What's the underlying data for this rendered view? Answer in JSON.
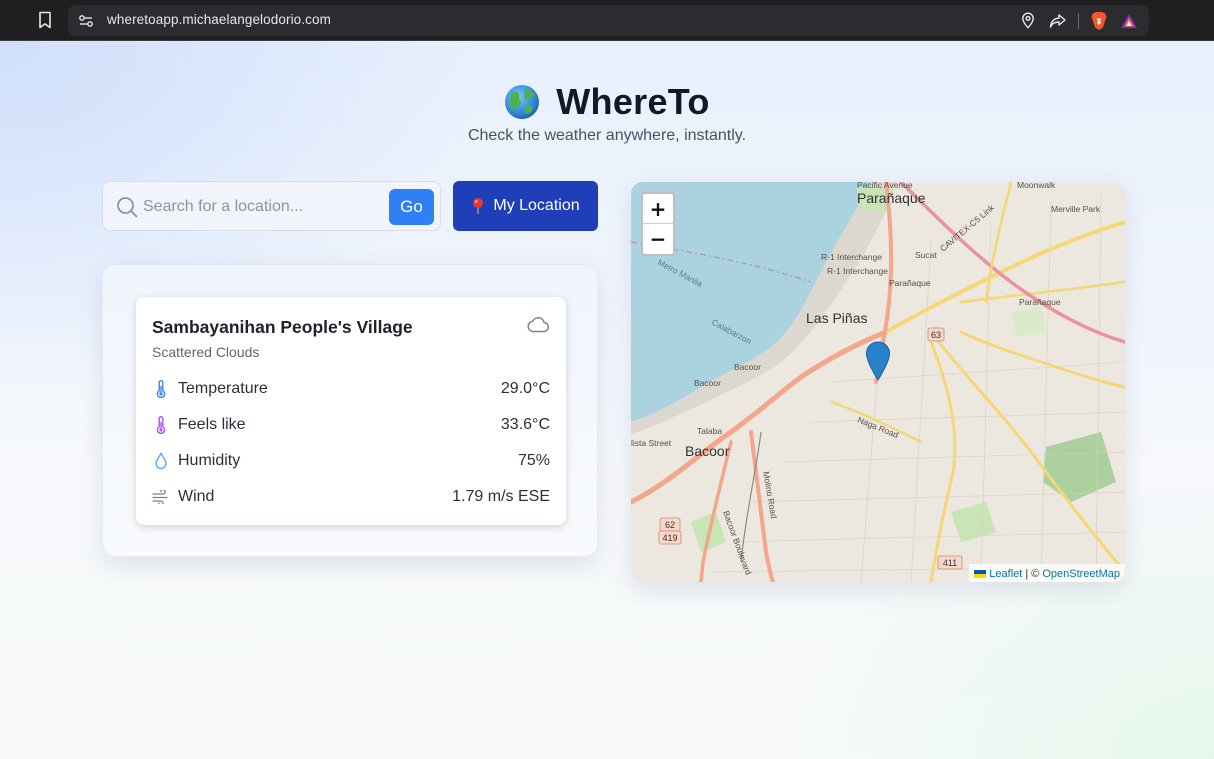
{
  "browser": {
    "url": "wheretoapp.michaelangelodorio.com"
  },
  "app": {
    "title": "WhereTo",
    "subtitle": "Check the weather anywhere, instantly."
  },
  "search": {
    "placeholder": "Search for a location...",
    "value": "",
    "go_label": "Go",
    "my_location_label": "My Location"
  },
  "weather": {
    "location": "Sambayanihan People's Village",
    "condition": "Scattered Clouds",
    "condition_icon": "cloud-icon",
    "rows": [
      {
        "label": "Temperature",
        "value": "29.0°C",
        "icon": "thermometer-icon"
      },
      {
        "label": "Feels like",
        "value": "33.6°C",
        "icon": "thermometer-icon"
      },
      {
        "label": "Humidity",
        "value": "75%",
        "icon": "droplet-icon"
      },
      {
        "label": "Wind",
        "value": "1.79 m/s ESE",
        "icon": "wind-icon"
      }
    ]
  },
  "map": {
    "zoom_in": "+",
    "zoom_out": "−",
    "attribution_leaflet": "Leaflet",
    "attribution_sep": "| ©",
    "attribution_osm": "OpenStreetMap",
    "labels": {
      "paranaque": "Parañaque",
      "las_pinas": "Las Piñas",
      "bacoor": "Bacoor",
      "pacific_avenue": "Pacific Avenue",
      "moonwalk": "Moonwalk",
      "merville_park": "Merville Park",
      "r1_interchange_a": "R-1 Interchange",
      "r1_interchange_b": "R-1 Interchange",
      "sucat": "Sucat",
      "paranaque_small": "Parañaque",
      "paranaque_district": "Parañaque",
      "cavitex": "CAVITEX-C5 Link",
      "metro_manila": "Metro Manila",
      "calabarzon": "Calabarzon",
      "bacoor_road": "Bacoor",
      "bacoor_road2": "Bacoor",
      "naga_road": "Naga Road",
      "talaba": "Talaba",
      "lista_street": "lista Street",
      "molino_road": "Molino Road",
      "bacoor_boulevard": "Bacoor Boulevard",
      "route_63": "63",
      "route_62": "62",
      "route_419": "419",
      "route_411": "411"
    }
  },
  "colors": {
    "primary_button": "#1e3fb8",
    "go_button": "#2f7ff5",
    "map_water": "#aad3df",
    "map_marker": "#2a81cb"
  }
}
